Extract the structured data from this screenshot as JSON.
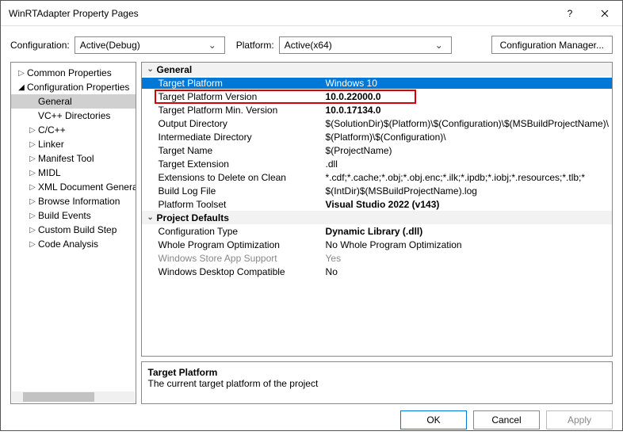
{
  "window": {
    "title": "WinRTAdapter Property Pages"
  },
  "toolbar": {
    "config_label": "Configuration:",
    "config_value": "Active(Debug)",
    "platform_label": "Platform:",
    "platform_value": "Active(x64)",
    "config_mgr": "Configuration Manager..."
  },
  "tree": {
    "common": "Common Properties",
    "configprops": "Configuration Properties",
    "items": [
      "General",
      "VC++ Directories",
      "C/C++",
      "Linker",
      "Manifest Tool",
      "MIDL",
      "XML Document Generator",
      "Browse Information",
      "Build Events",
      "Custom Build Step",
      "Code Analysis"
    ]
  },
  "groups": {
    "general": "General",
    "defaults": "Project Defaults"
  },
  "props": {
    "target_platform": {
      "name": "Target Platform",
      "value": "Windows 10"
    },
    "tp_version": {
      "name": "Target Platform Version",
      "value": "10.0.22000.0"
    },
    "tp_min_version": {
      "name": "Target Platform Min. Version",
      "value": "10.0.17134.0"
    },
    "out_dir": {
      "name": "Output Directory",
      "value": "$(SolutionDir)$(Platform)\\$(Configuration)\\$(MSBuildProjectName)\\"
    },
    "int_dir": {
      "name": "Intermediate Directory",
      "value": "$(Platform)\\$(Configuration)\\"
    },
    "target_name": {
      "name": "Target Name",
      "value": "$(ProjectName)"
    },
    "target_ext": {
      "name": "Target Extension",
      "value": ".dll"
    },
    "ext_clean": {
      "name": "Extensions to Delete on Clean",
      "value": "*.cdf;*.cache;*.obj;*.obj.enc;*.ilk;*.ipdb;*.iobj;*.resources;*.tlb;*"
    },
    "build_log": {
      "name": "Build Log File",
      "value": "$(IntDir)$(MSBuildProjectName).log"
    },
    "toolset": {
      "name": "Platform Toolset",
      "value": "Visual Studio 2022 (v143)"
    },
    "config_type": {
      "name": "Configuration Type",
      "value": "Dynamic Library (.dll)"
    },
    "wpo": {
      "name": "Whole Program Optimization",
      "value": "No Whole Program Optimization"
    },
    "store": {
      "name": "Windows Store App Support",
      "value": "Yes"
    },
    "desktop": {
      "name": "Windows Desktop Compatible",
      "value": "No"
    }
  },
  "desc": {
    "title": "Target Platform",
    "body": "The current target platform of the project"
  },
  "buttons": {
    "ok": "OK",
    "cancel": "Cancel",
    "apply": "Apply"
  }
}
